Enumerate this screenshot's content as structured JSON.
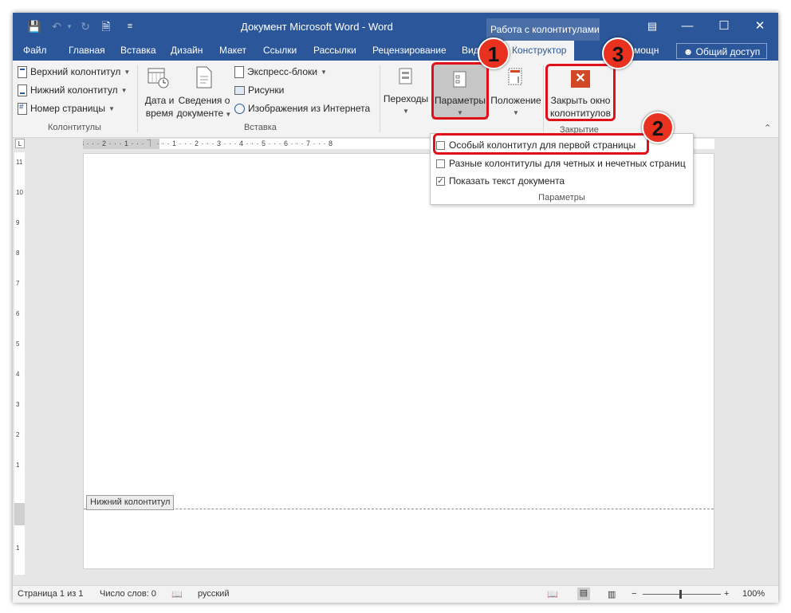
{
  "window": {
    "title": "Документ Microsoft Word - Word",
    "context_group": "Работа с колонтитулами",
    "controls": [
      "minimize",
      "maximize",
      "close"
    ]
  },
  "quick_access": [
    "save-icon",
    "undo-icon",
    "redo-icon",
    "new-doc-icon",
    "customize-icon"
  ],
  "tabs": [
    {
      "label": "Файл"
    },
    {
      "label": "Главная"
    },
    {
      "label": "Вставка"
    },
    {
      "label": "Дизайн"
    },
    {
      "label": "Макет"
    },
    {
      "label": "Ссылки"
    },
    {
      "label": "Рассылки"
    },
    {
      "label": "Рецензирование"
    },
    {
      "label": "Вид"
    },
    {
      "label": "Конструктор"
    },
    {
      "label": "мощн"
    }
  ],
  "share_label": "Общий доступ",
  "ribbon": {
    "kolontituly": {
      "header": "Верхний колонтитул",
      "footer": "Нижний колонтитул",
      "page_number": "Номер страницы",
      "group_label": "Колонтитулы"
    },
    "vstavka": {
      "date_line1": "Дата и",
      "date_line2": "время",
      "info_line1": "Сведения о",
      "info_line2": "документе",
      "quick_parts": "Экспресс-блоки",
      "pictures": "Рисунки",
      "online_pictures": "Изображения из Интернета",
      "group_label": "Вставка"
    },
    "navigation": "Переходы",
    "options": "Параметры",
    "position": "Положение",
    "close": {
      "line1": "Закрыть окно",
      "line2": "колонтитулов",
      "group_label": "Закрытие"
    }
  },
  "ruler": {
    "h_marks": "3 · · · 2 · · · 1 · · · ⏋ · · · 1 · · · 2 · · · 3 · · · 4 · · · 5 · · · 6 · · · 7 · · · 8",
    "v_marks": [
      "1",
      "2",
      "3",
      "4",
      "5",
      "6",
      "7",
      "8",
      "9",
      "10",
      "11",
      "1"
    ]
  },
  "document": {
    "footer_tag": "Нижний колонтитул"
  },
  "options_dropdown": {
    "items": [
      {
        "label": "Особый колонтитул для первой страницы",
        "checked": false
      },
      {
        "label": "Разные колонтитулы для четных и нечетных страниц",
        "checked": false
      },
      {
        "label": "Показать текст документа",
        "checked": true
      }
    ],
    "group_label": "Параметры"
  },
  "annotations": {
    "markers": [
      "1",
      "2",
      "3"
    ],
    "color": "#e0101b"
  },
  "statusbar": {
    "page": "Страница 1 из 1",
    "words": "Число слов: 0",
    "language": "русский",
    "zoom": "100%",
    "zoom_minus": "−",
    "zoom_plus": "+"
  },
  "colors": {
    "titlebar": "#2b579a",
    "ribbon": "#f3f3f3",
    "close_icon": "#d24726"
  }
}
